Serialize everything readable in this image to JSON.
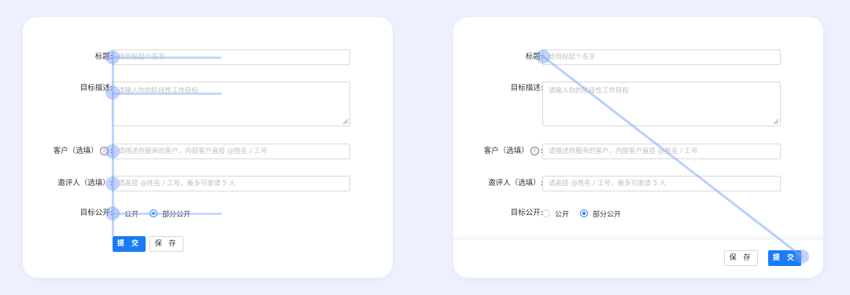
{
  "form": {
    "title_label": "标题:",
    "title_placeholder": "给目标起个名字",
    "desc_label": "目标描述:",
    "desc_placeholder": "请输入你的阶段性工作目标",
    "client_label": "客户（选填）",
    "client_label_suffix": ":",
    "client_info_icon": "i",
    "client_placeholder": "请描述你服务的客户，内部客户直接 @姓名 / 工号",
    "reviewer_label": "邀评人（选填）:",
    "reviewer_placeholder": "请直接 @姓名 / 工号，最多可邀请 5 人",
    "visibility_label": "目标公开:",
    "visibility_options": [
      {
        "label": "公开",
        "checked": false
      },
      {
        "label": "部分公开",
        "checked": true
      }
    ],
    "submit_label": "提 交",
    "save_label": "保 存"
  },
  "colors": {
    "background": "#eef1fd",
    "primary": "#1a7cf5",
    "guide": "#96b9fa"
  }
}
